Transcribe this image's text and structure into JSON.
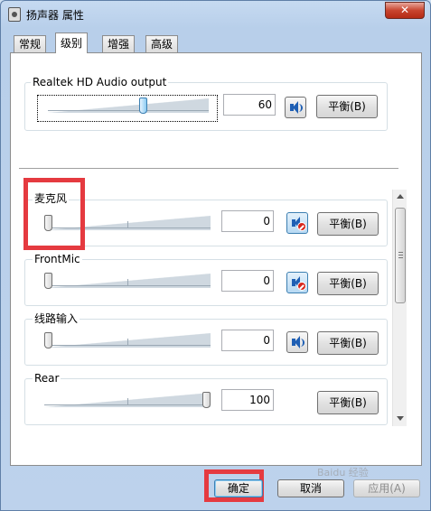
{
  "window": {
    "title": "扬声器 属性",
    "close_label": "✕"
  },
  "tabs": [
    {
      "label": "常规"
    },
    {
      "label": "级别"
    },
    {
      "label": "增强"
    },
    {
      "label": "高级"
    }
  ],
  "output": {
    "label": "Realtek HD Audio output",
    "value": "60",
    "level": 60,
    "balance_label": "平衡(B)"
  },
  "inputs": [
    {
      "label": "麦克风",
      "value": "0",
      "level": 0,
      "muted": true,
      "balance_label": "平衡(B)"
    },
    {
      "label": "FrontMic",
      "value": "0",
      "level": 0,
      "muted": true,
      "balance_label": "平衡(B)"
    },
    {
      "label": "线路输入",
      "value": "0",
      "level": 0,
      "muted": false,
      "balance_label": "平衡(B)"
    },
    {
      "label": "Rear",
      "value": "100",
      "level": 100,
      "muted": false,
      "balance_label": "平衡(B)"
    }
  ],
  "footer": {
    "ok_label": "确定",
    "cancel_label": "取消",
    "apply_label": "应用(A)"
  },
  "colors": {
    "highlight": "#e53a40",
    "accent": "#3c7fb1"
  },
  "watermark": "Baidu 经验"
}
